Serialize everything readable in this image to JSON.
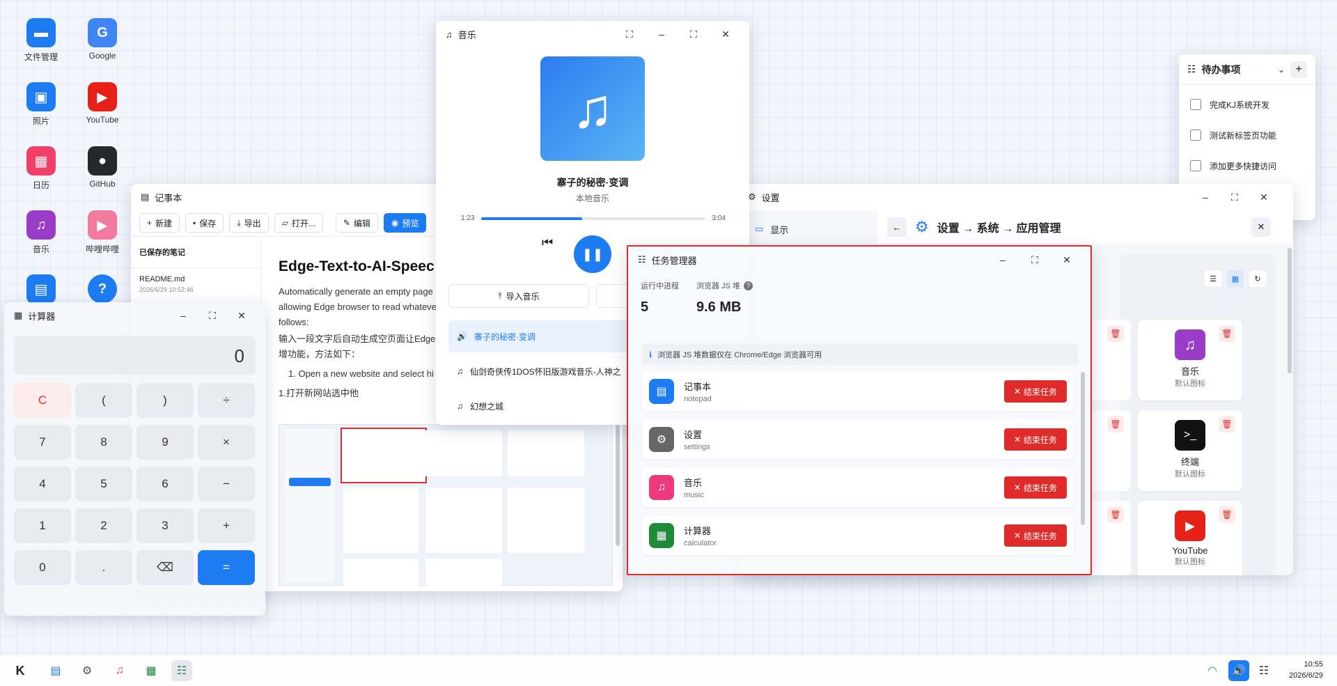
{
  "desktop": {
    "icons": [
      {
        "label": "文件管理",
        "color": "#1e7cf2",
        "glyph": "▬",
        "icon": "folder-icon"
      },
      {
        "label": "Google",
        "color": "#3f86f4",
        "glyph": "G",
        "icon": "google-icon"
      },
      {
        "label": "照片",
        "color": "#1e7cf2",
        "glyph": "▣",
        "icon": "photos-icon"
      },
      {
        "label": "YouTube",
        "color": "#e62117",
        "glyph": "▶",
        "icon": "youtube-icon"
      },
      {
        "label": "日历",
        "color": "#f0406a",
        "glyph": "▦",
        "icon": "calendar-icon"
      },
      {
        "label": "GitHub",
        "color": "#24292e",
        "glyph": "●",
        "icon": "github-icon"
      },
      {
        "label": "音乐",
        "color": "#9b3cc8",
        "glyph": "♫",
        "icon": "music-icon"
      },
      {
        "label": "哔哩哔哩",
        "color": "#f27aa0",
        "glyph": "▶",
        "icon": "bilibili-icon"
      },
      {
        "label": "",
        "color": "#1e7cf2",
        "glyph": "▤",
        "icon": "document-icon"
      },
      {
        "label": "",
        "color": "#1e7cf2",
        "glyph": "?",
        "icon": "help-icon"
      }
    ]
  },
  "notepad": {
    "title": "记事本",
    "toolbar": {
      "new": "新建",
      "save": "保存",
      "export": "导出",
      "open": "打开...",
      "edit": "编辑",
      "preview": "预览"
    },
    "saved_header": "已保存的笔记",
    "note": {
      "name": "README.md",
      "time": "2026/6/29 10:52:46"
    },
    "doc": {
      "heading": "Edge-Text-to-AI-Speec",
      "p1": "Automatically generate an empty page",
      "p2": "allowing Edge browser to read whateve",
      "p3": "follows:",
      "p4": "输入一段文字后自动生成空页面让Edge",
      "p5": "增功能，方法如下：",
      "li1": "1. Open a new website and select hi",
      "li2": "1.打开新网站选中他"
    }
  },
  "music": {
    "title": "音乐",
    "song": "寨子的秘密·变调",
    "source": "本地音乐",
    "time_current": "1:23",
    "time_total": "3:04",
    "progress": 0.45,
    "import_label": "导入音乐",
    "playlist": [
      "寨子的秘密·变调",
      "仙剑奇侠传1DOS怀旧版游戏音乐-人神之",
      "幻想之城"
    ]
  },
  "calculator": {
    "title": "计算器",
    "display": "0",
    "keys": [
      [
        "C",
        "(",
        ")",
        "÷"
      ],
      [
        "7",
        "8",
        "9",
        "×"
      ],
      [
        "4",
        "5",
        "6",
        "−"
      ],
      [
        "1",
        "2",
        "3",
        "+"
      ],
      [
        "0",
        ".",
        "⌫",
        "="
      ]
    ]
  },
  "taskmanager": {
    "title": "任务管理器",
    "proc_label": "运行中进程",
    "proc_value": "5",
    "heap_label": "浏览器 JS 堆",
    "heap_value": "9.6 MB",
    "notice": "浏览器 JS 堆数据仅在 Chrome/Edge 浏览器可用",
    "end_label": "结束任务",
    "tasks": [
      {
        "name": "记事本",
        "id": "notepad",
        "color": "#1e7cf2",
        "glyph": "▤"
      },
      {
        "name": "设置",
        "id": "settings",
        "color": "#666",
        "glyph": "⚙"
      },
      {
        "name": "音乐",
        "id": "music",
        "color": "#ec3a7c",
        "glyph": "♫"
      },
      {
        "name": "计算器",
        "id": "calculator",
        "color": "#1f8a3a",
        "glyph": "▦"
      }
    ]
  },
  "settings": {
    "title": "设置",
    "side_item": "显示",
    "breadcrumb": "设置 → 系统 → 应用管理",
    "cards": [
      {
        "name": "音乐",
        "sub": "默认图标",
        "color": "#9b3cc8",
        "glyph": "♫"
      },
      {
        "name": "终端",
        "sub": "默认图标",
        "color": "#111",
        "glyph": ">_"
      },
      {
        "name": "YouTube",
        "sub": "默认图标",
        "color": "#e62117",
        "glyph": "▶"
      }
    ]
  },
  "todo": {
    "title": "待办事项",
    "items": [
      "完成KJ系统开发",
      "测试新标签页功能",
      "添加更多快捷访问"
    ]
  },
  "taskbar": {
    "time": "10:55",
    "date": "2026/6/29"
  }
}
